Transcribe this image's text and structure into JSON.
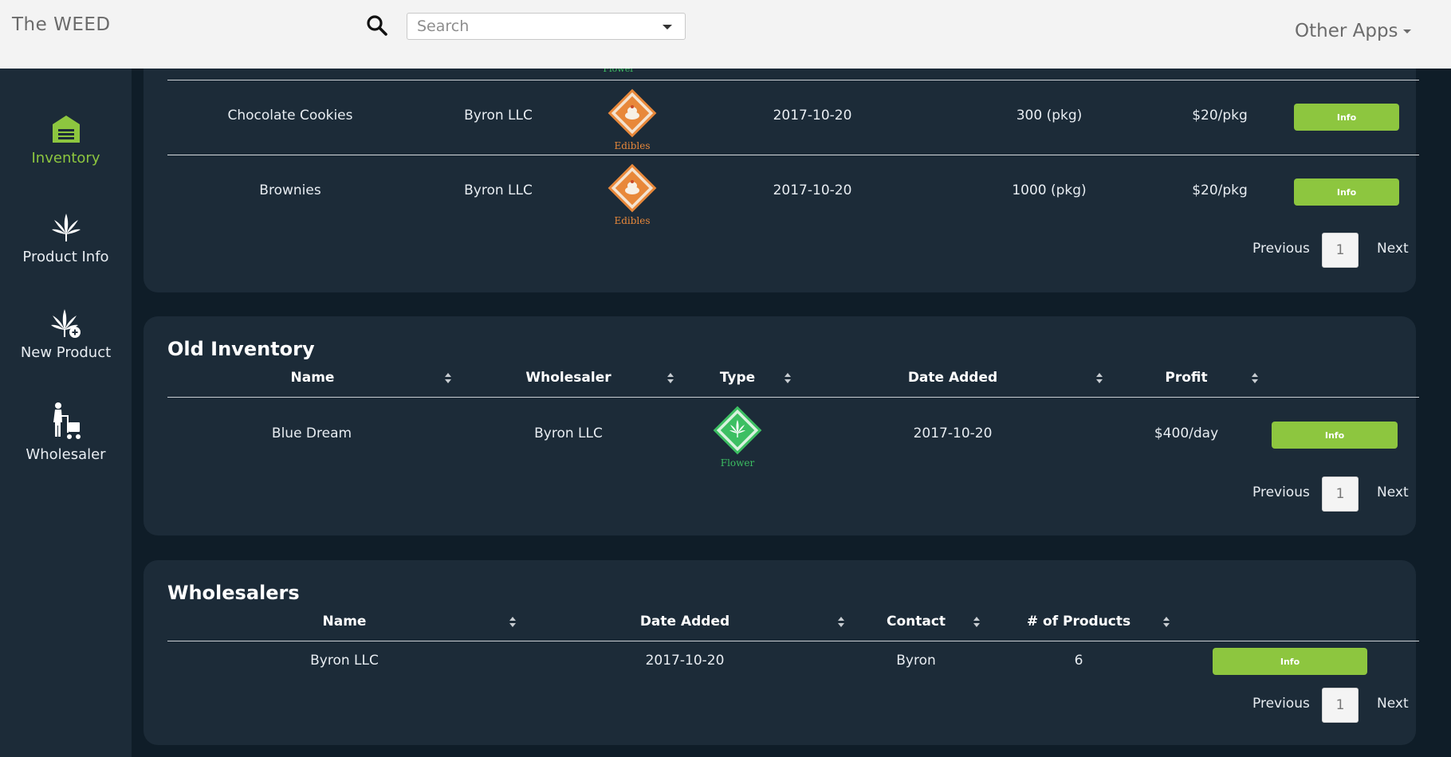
{
  "app": {
    "title": "The WEED",
    "other_apps": "Other Apps"
  },
  "search": {
    "placeholder": "Search",
    "value": ""
  },
  "sidebar": {
    "items": [
      {
        "label": "Inventory",
        "icon": "warehouse-icon",
        "active": true
      },
      {
        "label": "Product Info",
        "icon": "cannabis-leaf-icon",
        "active": false
      },
      {
        "label": "New Product",
        "icon": "cannabis-leaf-plus-icon",
        "active": false
      },
      {
        "label": "Wholesaler",
        "icon": "person-cart-icon",
        "active": false
      }
    ]
  },
  "current_inventory": {
    "clipped_type_label": "Flower",
    "rows": [
      {
        "name": "Chocolate Cookies",
        "wholesaler": "Byron LLC",
        "type": "Edibles",
        "date_added": "2017-10-20",
        "quantity": "300 (pkg)",
        "price": "$20/pkg",
        "action": "Info"
      },
      {
        "name": "Brownies",
        "wholesaler": "Byron LLC",
        "type": "Edibles",
        "date_added": "2017-10-20",
        "quantity": "1000 (pkg)",
        "price": "$20/pkg",
        "action": "Info"
      }
    ],
    "pager": {
      "prev": "Previous",
      "page": "1",
      "next": "Next"
    }
  },
  "old_inventory": {
    "title": "Old Inventory",
    "columns": [
      "Name",
      "Wholesaler",
      "Type",
      "Date Added",
      "Profit"
    ],
    "rows": [
      {
        "name": "Blue Dream",
        "wholesaler": "Byron LLC",
        "type": "Flower",
        "date_added": "2017-10-20",
        "profit": "$400/day",
        "action": "Info"
      }
    ],
    "pager": {
      "prev": "Previous",
      "page": "1",
      "next": "Next"
    }
  },
  "wholesalers": {
    "title": "Wholesalers",
    "columns": [
      "Name",
      "Date Added",
      "Contact",
      "# of Products"
    ],
    "rows": [
      {
        "name": "Byron LLC",
        "date_added": "2017-10-20",
        "contact": "Byron",
        "products": "6",
        "action": "Info"
      }
    ],
    "pager": {
      "prev": "Previous",
      "page": "1",
      "next": "Next"
    }
  },
  "colors": {
    "accent_green": "#8dc63f",
    "page_bg": "#0f1d28",
    "panel_bg": "#1c2b38",
    "topbar_bg": "#f3f3f3",
    "edibles_orange": "#e8883a",
    "flower_green": "#3cbf62"
  }
}
